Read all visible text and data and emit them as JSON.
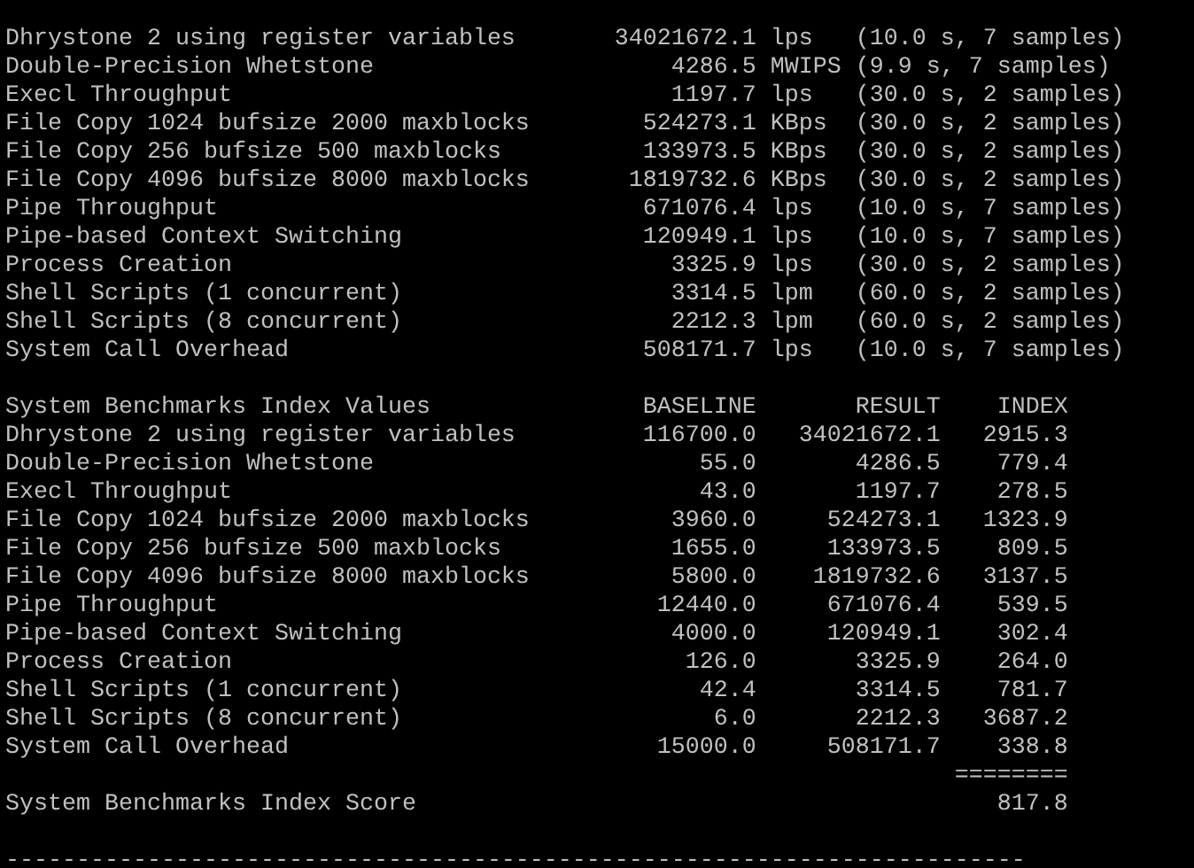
{
  "results": [
    {
      "name": "Dhrystone 2 using register variables",
      "value": "34021672.1",
      "unit": "lps",
      "detail": "(10.0 s, 7 samples)"
    },
    {
      "name": "Double-Precision Whetstone",
      "value": "4286.5",
      "unit": "MWIPS",
      "detail": "(9.9 s, 7 samples)"
    },
    {
      "name": "Execl Throughput",
      "value": "1197.7",
      "unit": "lps",
      "detail": "(30.0 s, 2 samples)"
    },
    {
      "name": "File Copy 1024 bufsize 2000 maxblocks",
      "value": "524273.1",
      "unit": "KBps",
      "detail": "(30.0 s, 2 samples)"
    },
    {
      "name": "File Copy 256 bufsize 500 maxblocks",
      "value": "133973.5",
      "unit": "KBps",
      "detail": "(30.0 s, 2 samples)"
    },
    {
      "name": "File Copy 4096 bufsize 8000 maxblocks",
      "value": "1819732.6",
      "unit": "KBps",
      "detail": "(30.0 s, 2 samples)"
    },
    {
      "name": "Pipe Throughput",
      "value": "671076.4",
      "unit": "lps",
      "detail": "(10.0 s, 7 samples)"
    },
    {
      "name": "Pipe-based Context Switching",
      "value": "120949.1",
      "unit": "lps",
      "detail": "(10.0 s, 7 samples)"
    },
    {
      "name": "Process Creation",
      "value": "3325.9",
      "unit": "lps",
      "detail": "(30.0 s, 2 samples)"
    },
    {
      "name": "Shell Scripts (1 concurrent)",
      "value": "3314.5",
      "unit": "lpm",
      "detail": "(60.0 s, 2 samples)"
    },
    {
      "name": "Shell Scripts (8 concurrent)",
      "value": "2212.3",
      "unit": "lpm",
      "detail": "(60.0 s, 2 samples)"
    },
    {
      "name": "System Call Overhead",
      "value": "508171.7",
      "unit": "lps",
      "detail": "(10.0 s, 7 samples)"
    }
  ],
  "index": {
    "title": "System Benchmarks Index Values",
    "columns": [
      "BASELINE",
      "RESULT",
      "INDEX"
    ],
    "rows": [
      {
        "name": "Dhrystone 2 using register variables",
        "baseline": "116700.0",
        "result": "34021672.1",
        "index": "2915.3"
      },
      {
        "name": "Double-Precision Whetstone",
        "baseline": "55.0",
        "result": "4286.5",
        "index": "779.4"
      },
      {
        "name": "Execl Throughput",
        "baseline": "43.0",
        "result": "1197.7",
        "index": "278.5"
      },
      {
        "name": "File Copy 1024 bufsize 2000 maxblocks",
        "baseline": "3960.0",
        "result": "524273.1",
        "index": "1323.9"
      },
      {
        "name": "File Copy 256 bufsize 500 maxblocks",
        "baseline": "1655.0",
        "result": "133973.5",
        "index": "809.5"
      },
      {
        "name": "File Copy 4096 bufsize 8000 maxblocks",
        "baseline": "5800.0",
        "result": "1819732.6",
        "index": "3137.5"
      },
      {
        "name": "Pipe Throughput",
        "baseline": "12440.0",
        "result": "671076.4",
        "index": "539.5"
      },
      {
        "name": "Pipe-based Context Switching",
        "baseline": "4000.0",
        "result": "120949.1",
        "index": "302.4"
      },
      {
        "name": "Process Creation",
        "baseline": "126.0",
        "result": "3325.9",
        "index": "264.0"
      },
      {
        "name": "Shell Scripts (1 concurrent)",
        "baseline": "42.4",
        "result": "3314.5",
        "index": "781.7"
      },
      {
        "name": "Shell Scripts (8 concurrent)",
        "baseline": "6.0",
        "result": "2212.3",
        "index": "3687.2"
      },
      {
        "name": "System Call Overhead",
        "baseline": "15000.0",
        "result": "508171.7",
        "index": "338.8"
      }
    ],
    "rule": "========",
    "score": {
      "label": "System Benchmarks Index Score",
      "value": "817.8"
    }
  },
  "divider": "------------------------------------------------------------------------"
}
